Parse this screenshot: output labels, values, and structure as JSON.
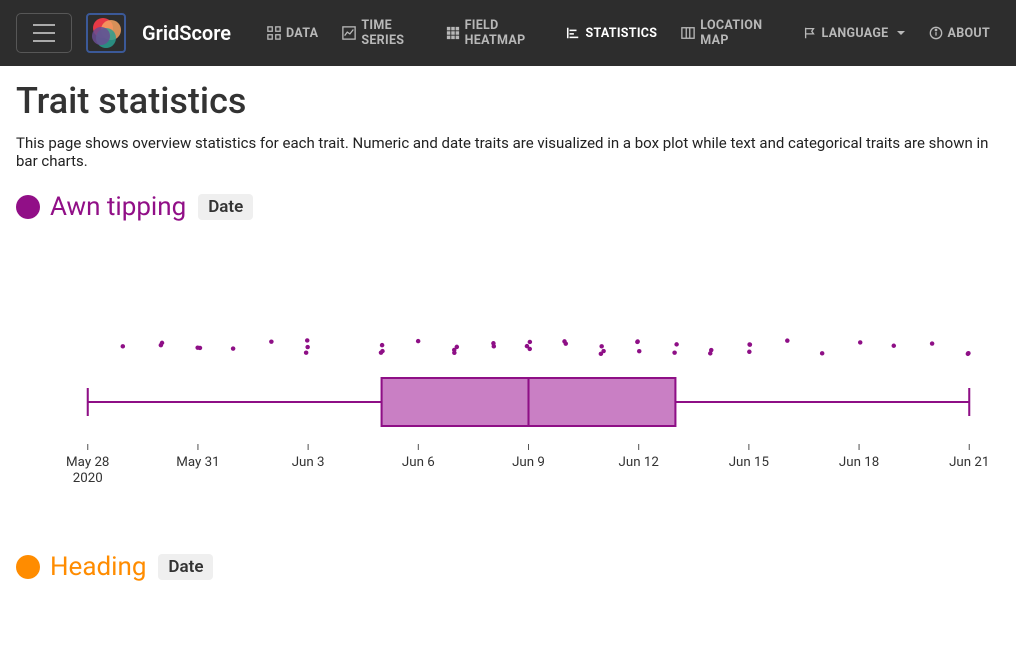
{
  "brand": "GridScore",
  "nav": {
    "data": "DATA",
    "timeseries": "TIME SERIES",
    "heatmap": "FIELD HEATMAP",
    "statistics": "STATISTICS",
    "locationmap": "LOCATION MAP",
    "language": "LANGUAGE",
    "about": "ABOUT"
  },
  "page": {
    "title": "Trait statistics",
    "desc": "This page shows overview statistics for each trait. Numeric and date traits are visualized in a box plot while text and categorical traits are shown in bar charts."
  },
  "traits": {
    "awn": {
      "name": "Awn tipping",
      "badge": "Date",
      "color": "#910f87"
    },
    "heading": {
      "name": "Heading",
      "badge": "Date",
      "color": "#ff8c00"
    }
  },
  "chart_data": {
    "type": "box",
    "title": "Awn tipping",
    "xlabel": "",
    "ylabel": "",
    "x_ticks": [
      "May 28",
      "May 31",
      "Jun 3",
      "Jun 6",
      "Jun 9",
      "Jun 12",
      "Jun 15",
      "Jun 18",
      "Jun 21"
    ],
    "x_tick_second": "2020",
    "x_range_numeric": [
      0,
      24
    ],
    "box": {
      "min": 0,
      "q1": 8,
      "median": 12,
      "q3": 16,
      "max": 24
    },
    "jitter_points_x": [
      1,
      2,
      2,
      3,
      3,
      4,
      5,
      6,
      6,
      6,
      8,
      8,
      8,
      9,
      10,
      10,
      10,
      11,
      11,
      12,
      12,
      12,
      13,
      13,
      14,
      14,
      14,
      15,
      15,
      15,
      16,
      16,
      17,
      17,
      18,
      18,
      18,
      19,
      20,
      21,
      22,
      23,
      24,
      24
    ]
  }
}
